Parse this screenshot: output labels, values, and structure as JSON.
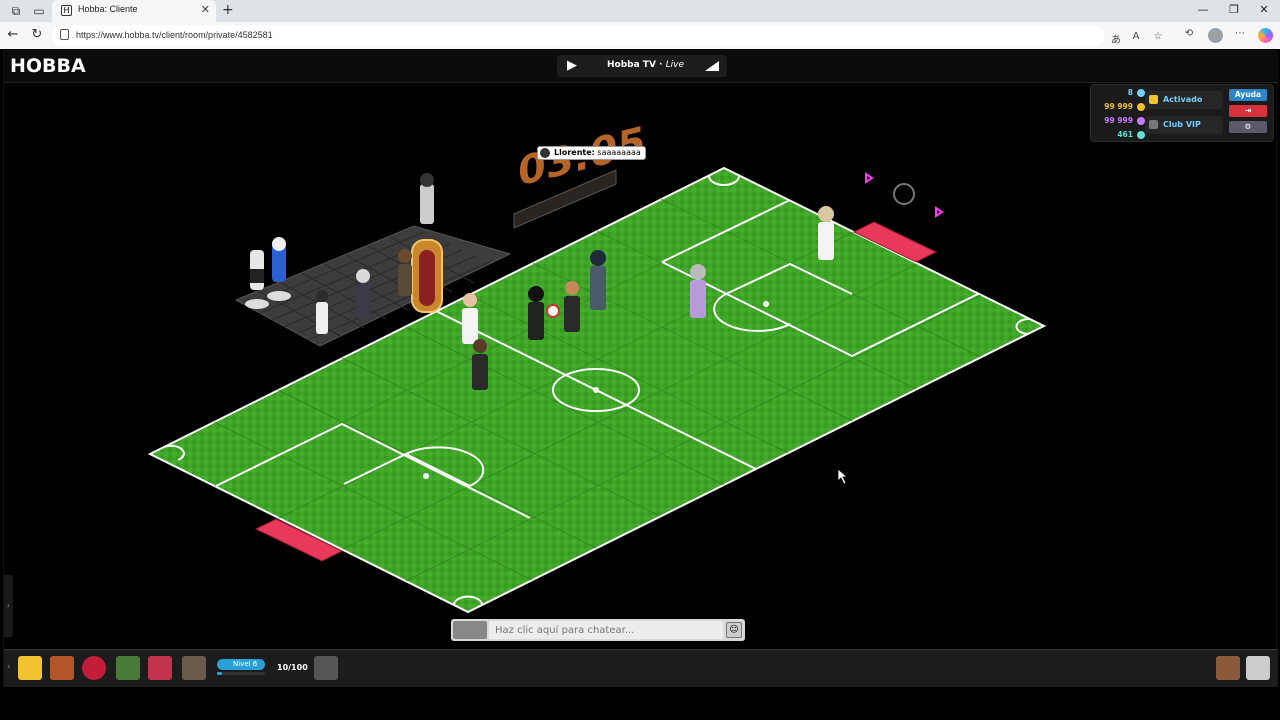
{
  "browser": {
    "tab_title": "Hobba: Cliente",
    "url": "https://www.hobba.tv/client/room/private/4582581"
  },
  "game": {
    "logo": "HOBBA",
    "tv": {
      "title": "Hobba TV",
      "separator": " · ",
      "status": "Live"
    },
    "scoreboard": "03:05",
    "chat_bubble": {
      "user": "Llorente:",
      "message": "saaaaaaaa"
    },
    "currencies": [
      {
        "value": "8",
        "color": "#6fd0ff"
      },
      {
        "value": "99 999",
        "color": "#f2c230"
      },
      {
        "value": "99 999",
        "color": "#c77bff"
      },
      {
        "value": "461",
        "color": "#5fe0d0"
      }
    ],
    "panel_buttons": [
      {
        "label": "Activado",
        "icon": "builder-icon"
      },
      {
        "label": "Club VIP",
        "icon": "vip-icon"
      }
    ],
    "help_label": "Ayuda",
    "chat": {
      "placeholder": "Haz clic aquí para chatear..."
    },
    "toolbar": {
      "level_label": "Nivel 6",
      "level_progress": 0.1,
      "level_count": "10/100"
    }
  },
  "colors": {
    "pitch": "#3fa627",
    "pitch_dark": "#358f20",
    "goal": "#e8395a",
    "accent": "#2aa1d6"
  }
}
